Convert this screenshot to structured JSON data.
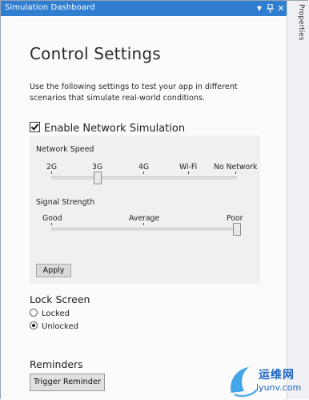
{
  "window": {
    "title": "Simulation Dashboard",
    "dropdown_icon": "chevron-down-icon",
    "pin_icon": "pin-icon",
    "close_icon": "close-icon",
    "side_tab": "Properties"
  },
  "page": {
    "heading": "Control Settings",
    "description": "Use the following settings to test your app in different scenarios that simulate real-world conditions."
  },
  "network": {
    "enable_label": "Enable Network Simulation",
    "enabled": true,
    "speed": {
      "label": "Network Speed",
      "options": [
        "2G",
        "3G",
        "4G",
        "Wi-Fi",
        "No Network"
      ],
      "selected": "3G"
    },
    "signal": {
      "label": "Signal Strength",
      "options": [
        "Good",
        "Average",
        "Poor"
      ],
      "selected": "Poor"
    },
    "apply_label": "Apply"
  },
  "lock_screen": {
    "heading": "Lock Screen",
    "options": [
      {
        "label": "Locked",
        "selected": false
      },
      {
        "label": "Unlocked",
        "selected": true
      }
    ]
  },
  "reminders": {
    "heading": "Reminders",
    "trigger_label": "Trigger Reminder"
  },
  "watermark": {
    "text_cn": "运维网",
    "url": "iyunv.com"
  }
}
